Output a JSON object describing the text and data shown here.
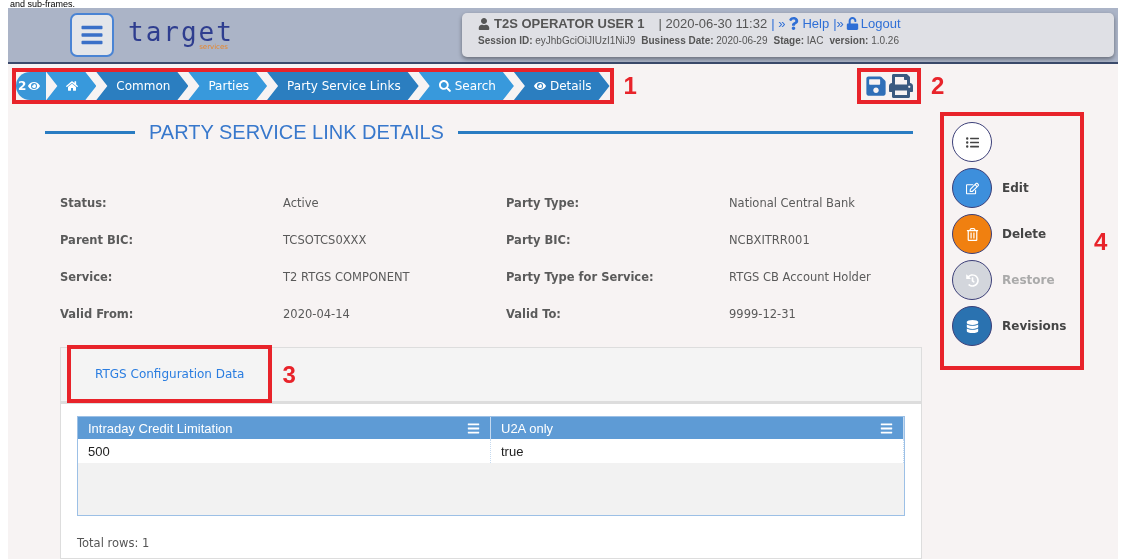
{
  "caption": "and sub-frames.",
  "header": {
    "logo": "target",
    "logo_sub": "services",
    "user": "T2S OPERATOR USER 1",
    "datetime": "| 2020-06-30 11:32",
    "links": [
      {
        "kind": "help",
        "prefix": "| »",
        "label": "Help"
      },
      {
        "kind": "logout",
        "prefix": "|»",
        "label": "Logout"
      }
    ],
    "session": [
      {
        "label": "Session ID:",
        "value": "eyJhbGciOiJIUzI1NiJ9"
      },
      {
        "label": "Business Date:",
        "value": "2020-06-29"
      },
      {
        "label": "Stage:",
        "value": "IAC"
      },
      {
        "label": "version:",
        "value": "1.0.26"
      }
    ]
  },
  "breadcrumb": {
    "count": "2",
    "annotation": "1",
    "items": [
      {
        "kind": "home"
      },
      {
        "kind": "text",
        "label": "Common"
      },
      {
        "kind": "text",
        "label": "Parties"
      },
      {
        "kind": "text",
        "label": "Party Service Links"
      },
      {
        "kind": "search",
        "label": "Search"
      },
      {
        "kind": "view",
        "label": "Details"
      }
    ]
  },
  "toolbar": {
    "annotation": "2",
    "tools": [
      {
        "kind": "save"
      },
      {
        "kind": "print"
      }
    ]
  },
  "title": "PARTY SERVICE LINK DETAILS",
  "details": [
    {
      "label": "Status:",
      "value": "Active"
    },
    {
      "label": "Party Type:",
      "value": "National Central Bank"
    },
    {
      "label": "Parent BIC:",
      "value": "TCSOTCS0XXX"
    },
    {
      "label": "Party BIC:",
      "value": "NCBXITRR001"
    },
    {
      "label": "Service:",
      "value": "T2 RTGS COMPONENT"
    },
    {
      "label": "Party Type for Service:",
      "value": "RTGS CB Account Holder"
    },
    {
      "label": "Valid From:",
      "value": "2020-04-14"
    },
    {
      "label": "Valid To:",
      "value": "9999-12-31"
    }
  ],
  "tabs": {
    "annotation": "3",
    "items": [
      {
        "label": "RTGS Configuration Data",
        "selected": true
      }
    ]
  },
  "table": {
    "columns": [
      "Intraday Credit Limitation",
      "U2A only"
    ],
    "rows": [
      [
        "500",
        "true"
      ]
    ],
    "footer": "Total rows: 1"
  },
  "actions": {
    "annotation": "4",
    "items": [
      {
        "kind": "list",
        "disabled": false
      },
      {
        "kind": "edit",
        "label": "Edit",
        "disabled": false
      },
      {
        "kind": "delete",
        "label": "Delete",
        "disabled": false
      },
      {
        "kind": "restore",
        "label": "Restore",
        "disabled": true
      },
      {
        "kind": "revisions",
        "label": "Revisions",
        "disabled": false
      }
    ]
  }
}
